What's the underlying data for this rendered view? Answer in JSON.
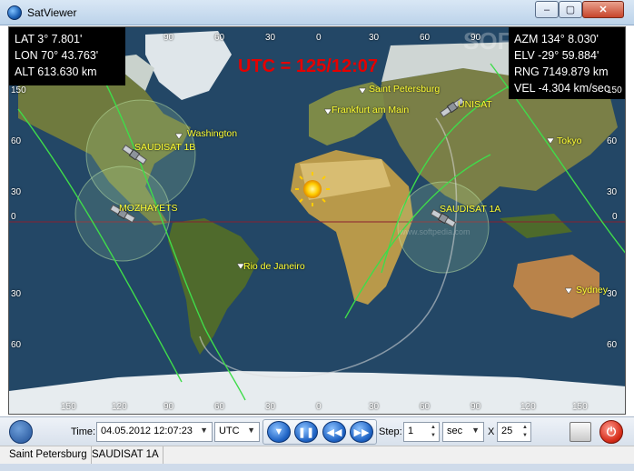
{
  "window": {
    "title": "SatViewer",
    "min_symbol": "–",
    "max_symbol": "▢",
    "close_symbol": "✕"
  },
  "map": {
    "watermark": "SOFTPEDIA",
    "watermark_url": "www.softpedia.com",
    "observer": {
      "lat": "LAT 3° 7.801'",
      "lon": "LON 70° 43.763'",
      "alt": "ALT 613.630 km"
    },
    "tracking": {
      "azm": "AZM 134° 8.030'",
      "elv": "ELV -29° 59.884'",
      "rng": "RNG 7149.879 km",
      "vel": "VEL -4.304 km/sec"
    },
    "utc": "UTC = 125/12:07",
    "top_ticks": [
      "90",
      "60",
      "30",
      "0",
      "30",
      "60",
      "90"
    ],
    "bottom_ticks": [
      "150",
      "120",
      "90",
      "60",
      "30",
      "0",
      "30",
      "60",
      "90",
      "120",
      "150"
    ],
    "left_ticks": [
      "150",
      "60",
      "30",
      "0",
      "30",
      "60"
    ],
    "right_ticks": [
      "150",
      "60",
      "30",
      "0",
      "30",
      "60"
    ],
    "cities": [
      {
        "name": "Washington"
      },
      {
        "name": "Saint Petersburg"
      },
      {
        "name": "Frankfurt am Main"
      },
      {
        "name": "Tokyo"
      },
      {
        "name": "Rio de Janeiro"
      },
      {
        "name": "Sydney"
      }
    ],
    "satellites": [
      {
        "name": "SAUDISAT 1B"
      },
      {
        "name": "MOZHAYETS"
      },
      {
        "name": "UNISAT"
      },
      {
        "name": "SAUDISAT 1A"
      }
    ],
    "colors": {
      "ocean": "#234766",
      "land": "#6f7a3e",
      "ground_track": "#3fdc4a",
      "footprint": "#bfe8a8",
      "utc_text": "#e40000",
      "label": "#ffff33"
    }
  },
  "toolbar": {
    "time_label": "Time:",
    "time_value": "04.05.2012 12:07:23",
    "timezone": "UTC",
    "step_label": "Step:",
    "step_value": "1",
    "step_unit": "sec",
    "multiplier_label": "X",
    "multiplier_value": "25",
    "play_down": "▼",
    "pause": "❚❚",
    "rewind": "◀◀",
    "forward": "▶▶",
    "power": "⏻"
  },
  "statusbar": {
    "location": "Saint Petersburg",
    "satellite": "SAUDISAT 1A"
  }
}
